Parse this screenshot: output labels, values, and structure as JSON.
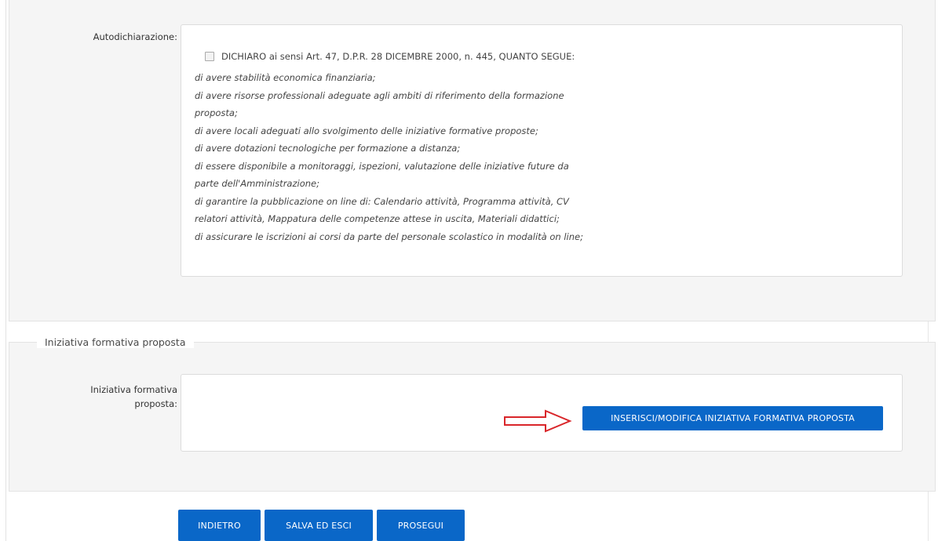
{
  "self_declaration": {
    "label": "Autodichiarazione:",
    "checkbox_checked": false,
    "checkbox_label": "DICHIARO ai sensi Art. 47, D.P.R. 28 DICEMBRE 2000, n. 445, QUANTO SEGUE:",
    "lines": [
      "di avere stabilità economica finanziaria;",
      "di avere risorse professionali adeguate agli ambiti di riferimento della formazione",
      "proposta;",
      "di avere locali adeguati allo svolgimento delle iniziative formative proposte;",
      "di avere dotazioni tecnologiche per formazione a distanza;",
      "di essere disponibile a monitoraggi, ispezioni, valutazione delle iniziative future da",
      "parte dell'Amministrazione;",
      "di garantire la pubblicazione on line di: Calendario attività, Programma attività, CV",
      "relatori attività, Mappatura delle competenze attese in uscita, Materiali didattici;",
      "di assicurare le iscrizioni ai corsi da parte del personale scolastico in modalità on line;"
    ]
  },
  "initiative": {
    "legend": "Iniziativa formativa proposta",
    "label_line1": "Iniziativa formativa",
    "label_line2": "proposta:",
    "insert_button": "INSERISCI/MODIFICA INIZIATIVA FORMATIVA PROPOSTA"
  },
  "footer": {
    "back_button": "INDIETRO",
    "save_exit_button": "SALVA ED ESCI",
    "next_button": "PROSEGUI"
  },
  "colors": {
    "primary_button": "#0a67c8",
    "arrow": "#d9262a",
    "section_background": "#f5f5f5"
  },
  "icons": {
    "annotation_arrow": "right-arrow-outline"
  }
}
